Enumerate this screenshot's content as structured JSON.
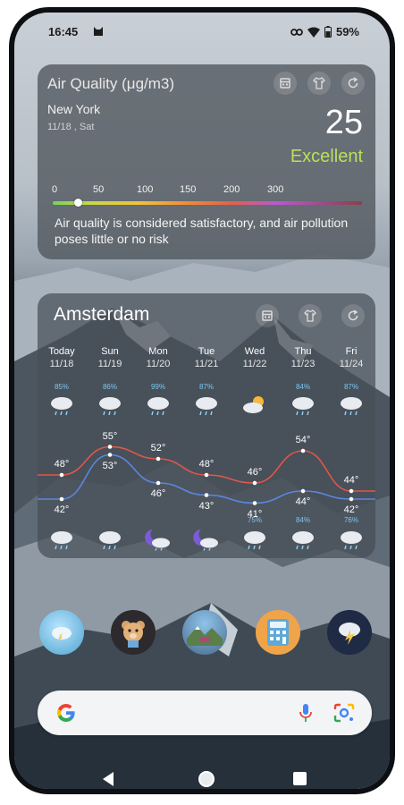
{
  "status_bar": {
    "time": "16:45",
    "battery": "59%"
  },
  "air_quality_widget": {
    "title": "Air Quality (μg/m3)",
    "city": "New York",
    "date": "11/18 , Sat",
    "value": "25",
    "status": "Excellent",
    "status_color": "#b8e05a",
    "scale_ticks": [
      "0",
      "50",
      "100",
      "150",
      "200",
      "300"
    ],
    "marker_fraction": 0.08,
    "description": "Air quality is considered satisfactory, and air pollution poses little or no risk",
    "buttons": [
      "calendar-icon",
      "shirt-icon",
      "refresh-icon"
    ]
  },
  "weather_widget": {
    "city": "Amsterdam",
    "buttons": [
      "calendar-icon",
      "shirt-icon",
      "refresh-icon"
    ],
    "days": [
      {
        "name": "Today",
        "date": "11/18",
        "day_precip": "85%",
        "day_icon": "rain-icon",
        "high": "48°",
        "low": "42°",
        "night_precip": "",
        "night_icon": "rain-icon"
      },
      {
        "name": "Sun",
        "date": "11/19",
        "day_precip": "86%",
        "day_icon": "rain-icon",
        "high": "55°",
        "low": "53°",
        "night_precip": "",
        "night_icon": "rain-icon"
      },
      {
        "name": "Mon",
        "date": "11/20",
        "day_precip": "99%",
        "day_icon": "rain-icon",
        "high": "52°",
        "low": "46°",
        "night_precip": "",
        "night_icon": "moon-cloud-icon"
      },
      {
        "name": "Tue",
        "date": "11/21",
        "day_precip": "87%",
        "day_icon": "rain-icon",
        "high": "48°",
        "low": "43°",
        "night_precip": "",
        "night_icon": "moon-cloud-icon"
      },
      {
        "name": "Wed",
        "date": "11/22",
        "day_precip": "",
        "day_icon": "partly-cloudy-icon",
        "high": "46°",
        "low": "41°",
        "night_precip": "75%",
        "night_icon": "rain-icon"
      },
      {
        "name": "Thu",
        "date": "11/23",
        "day_precip": "84%",
        "day_icon": "rain-icon",
        "high": "54°",
        "low": "44°",
        "night_precip": "84%",
        "night_icon": "rain-icon"
      },
      {
        "name": "Fri",
        "date": "11/24",
        "day_precip": "87%",
        "day_icon": "rain-icon",
        "high": "44°",
        "low": "42°",
        "night_precip": "76%",
        "night_icon": "rain-icon"
      }
    ],
    "high_line_color": "#e0574a",
    "low_line_color": "#5b86e0"
  },
  "dock": {
    "apps": [
      "weather-cloud-app-icon",
      "bear-app-icon",
      "landscape-app-icon",
      "calculator-app-icon",
      "thunderstorm-app-icon"
    ]
  },
  "search_bar": {
    "logo": "google-g-icon",
    "voice": "microphone-icon",
    "lens": "lens-icon"
  }
}
